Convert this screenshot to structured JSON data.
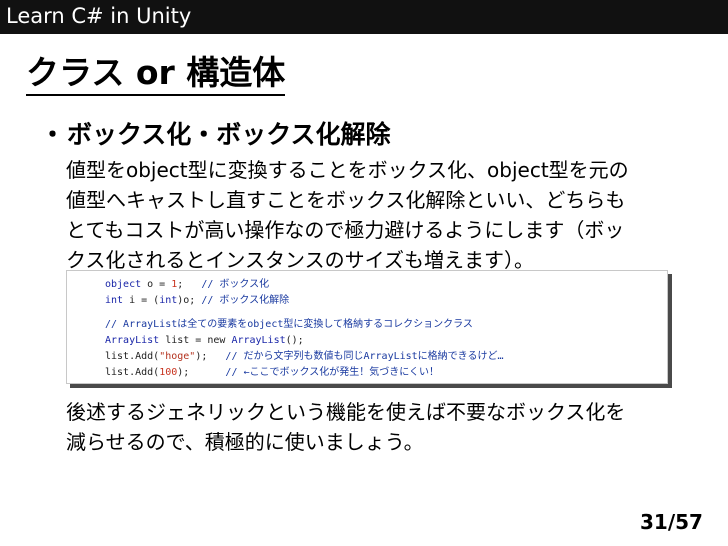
{
  "header": {
    "title": "Learn C# in Unity"
  },
  "slide": {
    "title": "クラス or 構造体",
    "bullet_symbol": "・",
    "bullet_heading": "ボックス化・ボックス化解除",
    "paragraph1": [
      "値型をobject型に変換することをボックス化、object型を元の",
      "値型へキャストし直すことをボックス化解除といい、どちらも",
      "とてもコストが高い操作なので極力避けるようにします（ボッ",
      "クス化されるとインスタンスのサイズも増えます）。"
    ],
    "paragraph2": [
      "後述するジェネリックという機能を使えば不要なボックス化を",
      "減らせるので、積極的に使いましょう。"
    ]
  },
  "code": {
    "line1": {
      "kw": "object",
      "a": " o = ",
      "num": "1",
      "b": ";   ",
      "comment": "// ボックス化"
    },
    "line2": {
      "kw1": "int",
      "a": " i = (",
      "kw2": "int",
      "b": ")o; ",
      "comment": "// ボックス化解除"
    },
    "line3": {
      "comment": "// ArrayListは全ての要素をobject型に変換して格納するコレクションクラス"
    },
    "line4": {
      "type1": "ArrayList",
      "a": " list = new ",
      "type2": "ArrayList",
      "b": "();"
    },
    "line5": {
      "a": "list.Add(",
      "str": "\"hoge\"",
      "b": ");   ",
      "comment": "// だから文字列も数値も同じArrayListに格納できるけど…"
    },
    "line6": {
      "a": "list.Add(",
      "num": "100",
      "b": ");      ",
      "comment": "// ←ここでボックス化が発生！気づきにくい！"
    }
  },
  "footer": {
    "page": "31/57"
  },
  "colors": {
    "header_bg": "#111111",
    "keyword": "#1a26a8",
    "number": "#c8321e",
    "comment": "#1a3aa0"
  }
}
